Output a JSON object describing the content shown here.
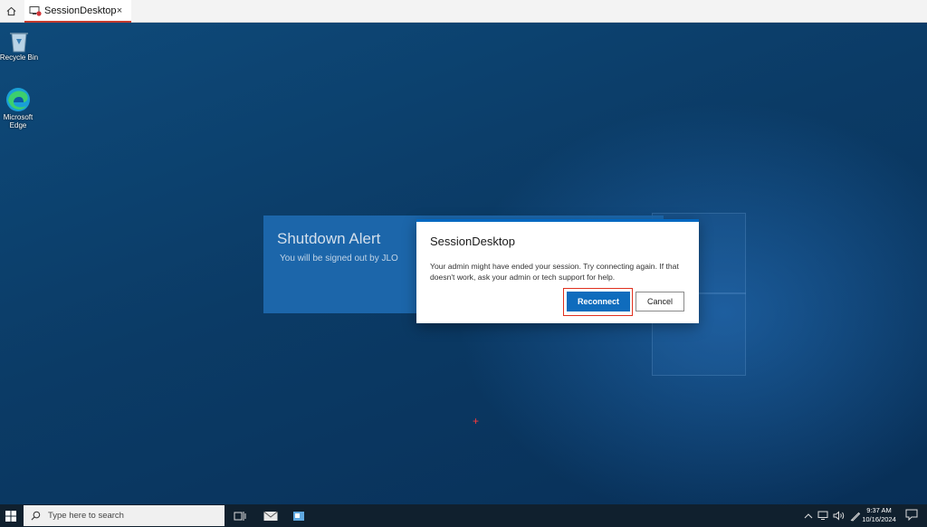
{
  "tabbar": {
    "home_icon": "home-icon",
    "tab_title": "SessionDesktop",
    "tab_icon": "remote-desktop-icon",
    "close_glyph": "×"
  },
  "desktop": {
    "icons": [
      {
        "label_line1": "Recycle Bin",
        "label_line2": "",
        "icon": "recycle-bin-icon"
      },
      {
        "label_line1": "Microsoft",
        "label_line2": "Edge",
        "icon": "edge-icon"
      }
    ]
  },
  "shutdown_alert": {
    "title": "Shutdown Alert",
    "message": "You will be signed out by JLO"
  },
  "dialog": {
    "title": "SessionDesktop",
    "message": "Your admin might have ended your session. Try connecting again. If that doesn't work, ask your admin or tech support for help.",
    "primary_label": "Reconnect",
    "secondary_label": "Cancel",
    "accent_color": "#0f6cbd",
    "focus_color": "#e0301e"
  },
  "taskbar": {
    "search_placeholder": "Type here to search",
    "clock_time": "9:37 AM",
    "clock_date": "10/16/2024",
    "tray_icons": [
      "chevron-up-icon",
      "network-icon",
      "volume-icon",
      "pen-icon"
    ]
  }
}
